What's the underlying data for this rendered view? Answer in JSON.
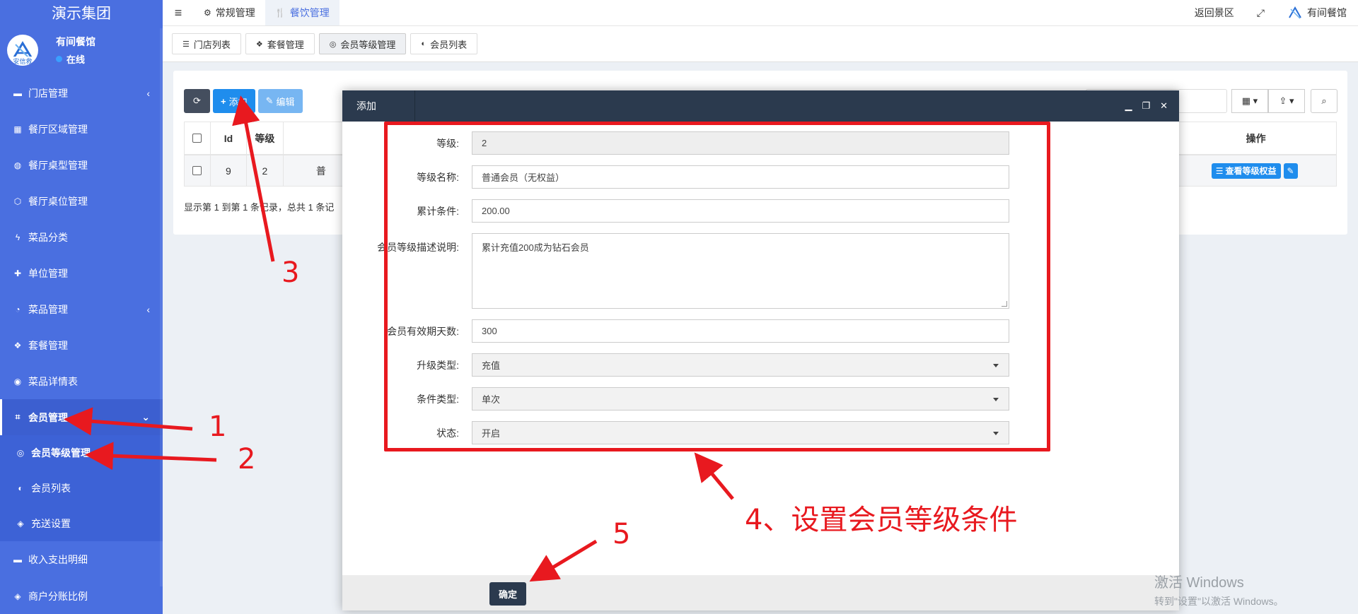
{
  "sidebar": {
    "brand": "演示集团",
    "user_name": "有间餐馆",
    "user_status": "在线",
    "avatar_text": "安信救",
    "items": [
      {
        "label": "门店管理",
        "icon": "folder-icon",
        "arrow": "‹"
      },
      {
        "label": "餐厅区域管理",
        "icon": "grid-icon"
      },
      {
        "label": "餐厅桌型管理",
        "icon": "globe-icon"
      },
      {
        "label": "餐厅桌位管理",
        "icon": "cube-icon"
      },
      {
        "label": "菜品分类",
        "icon": "bolt-icon"
      },
      {
        "label": "单位管理",
        "icon": "puzzle-icon"
      },
      {
        "label": "菜品管理",
        "icon": "dashboard-icon",
        "arrow": "‹"
      },
      {
        "label": "套餐管理",
        "icon": "dropbox-icon"
      },
      {
        "label": "菜品详情表",
        "icon": "eye-icon"
      },
      {
        "label": "会员管理",
        "icon": "binoculars-icon",
        "arrow": "⌄"
      }
    ],
    "subitems": [
      {
        "label": "会员等级管理",
        "icon": "target-icon"
      },
      {
        "label": "会员列表",
        "icon": "circle-icon"
      },
      {
        "label": "充送设置",
        "icon": "compass-icon"
      }
    ],
    "bottom_items": [
      {
        "label": "收入支出明细",
        "icon": "coffee-icon"
      },
      {
        "label": "商户分账比例",
        "icon": "compass-icon"
      }
    ]
  },
  "topbar": {
    "tabs": [
      {
        "label": "常规管理"
      },
      {
        "label": "餐饮管理"
      }
    ],
    "back_label": "返回景区",
    "account_name": "有间餐馆"
  },
  "subtabs": [
    "门店列表",
    "套餐管理",
    "会员等级管理",
    "会员列表"
  ],
  "toolbar": {
    "add_label": "添加",
    "edit_label": "编辑"
  },
  "table": {
    "headers": [
      "Id",
      "等级",
      "操作"
    ],
    "row": {
      "id": "9",
      "level": "2",
      "partial": "普",
      "view_label": "查看等级权益"
    },
    "pagination": "显示第 1 到第 1 条记录，总共 1 条记"
  },
  "modal": {
    "title": "添加",
    "fields": [
      {
        "label": "等级:",
        "value": "2",
        "type": "readonly"
      },
      {
        "label": "等级名称:",
        "value": "普通会员（无权益）",
        "type": "text"
      },
      {
        "label": "累计条件:",
        "value": "200.00",
        "type": "text"
      },
      {
        "label": "会员等级描述说明:",
        "value": "累计充值200成为钻石会员",
        "type": "textarea"
      },
      {
        "label": "会员有效期天数:",
        "value": "300",
        "type": "text"
      },
      {
        "label": "升级类型:",
        "value": "充值",
        "type": "select"
      },
      {
        "label": "条件类型:",
        "value": "单次",
        "type": "select"
      },
      {
        "label": "状态:",
        "value": "开启",
        "type": "select"
      }
    ],
    "confirm_label": "确定"
  },
  "annotations": {
    "n1": "1",
    "n2": "2",
    "n3": "3",
    "n4": "4、设置会员等级条件",
    "n5": "5",
    "color": "#e8191f"
  },
  "watermark": {
    "title": "激活 Windows",
    "sub": "转到\"设置\"以激活 Windows。"
  },
  "colors": {
    "sidebar": "#4a6fe0",
    "primary": "#1f8ded",
    "modal_header": "#2b3a4e"
  }
}
